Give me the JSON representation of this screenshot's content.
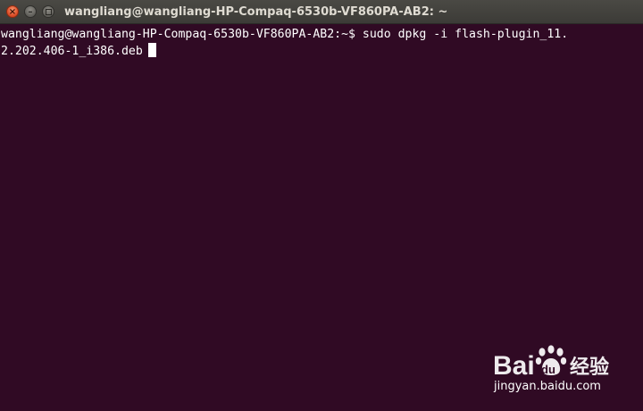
{
  "window": {
    "title": "wangliang@wangliang-HP-Compaq-6530b-VF860PA-AB2: ~",
    "buttons": {
      "close_glyph": "×",
      "minimize_glyph": "–"
    }
  },
  "terminal": {
    "lines": [
      "wangliang@wangliang-HP-Compaq-6530b-VF860PA-AB2:~$ sudo dpkg -i flash-plugin_11.",
      "2.202.406-1_i386.deb"
    ],
    "colors": {
      "background": "#300a24",
      "foreground": "#ffffff"
    }
  },
  "watermark": {
    "logo_text": "Bai 经验",
    "url": "jingyan.baidu.com"
  }
}
